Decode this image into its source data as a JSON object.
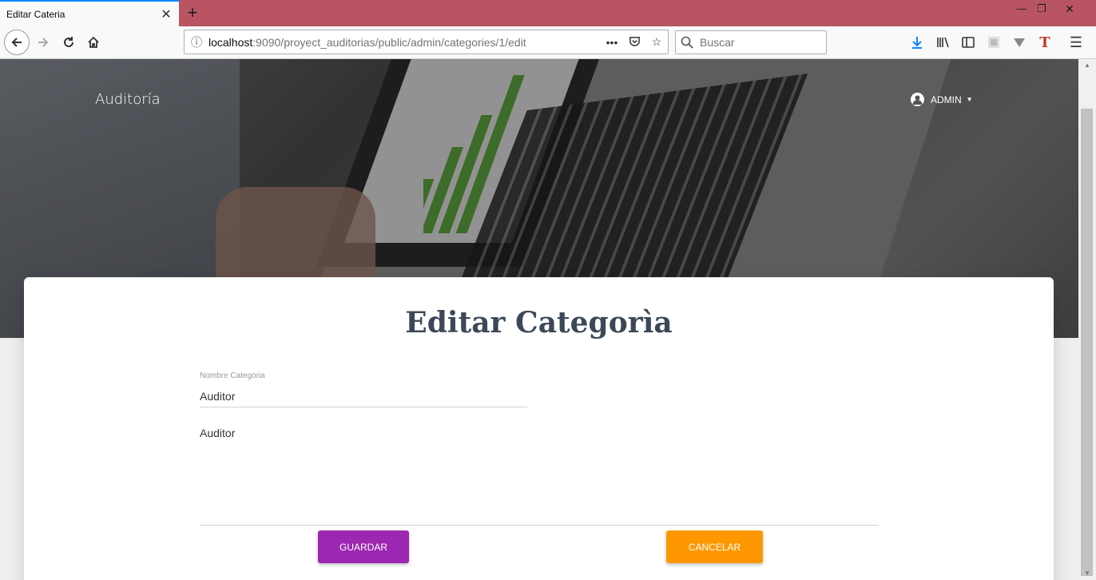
{
  "browser": {
    "tab_title": "Editar Cateria",
    "url_host": "localhost",
    "url_rest": ":9090/proyect_auditorias/public/admin/categories/1/edit",
    "search_placeholder": "Buscar"
  },
  "header": {
    "brand": "Auditoría",
    "user_label": "ADMIN"
  },
  "form": {
    "title": "Editar Categorìa",
    "name_label": "Nombre Categoria",
    "name_value": "Auditor",
    "description_value": "Auditor",
    "save_label": "GUARDAR",
    "cancel_label": "CANCELAR"
  },
  "colors": {
    "tabbar": "#b95562",
    "save_button": "#9c27b0",
    "cancel_button": "#ff9800",
    "title_text": "#3c4858"
  }
}
